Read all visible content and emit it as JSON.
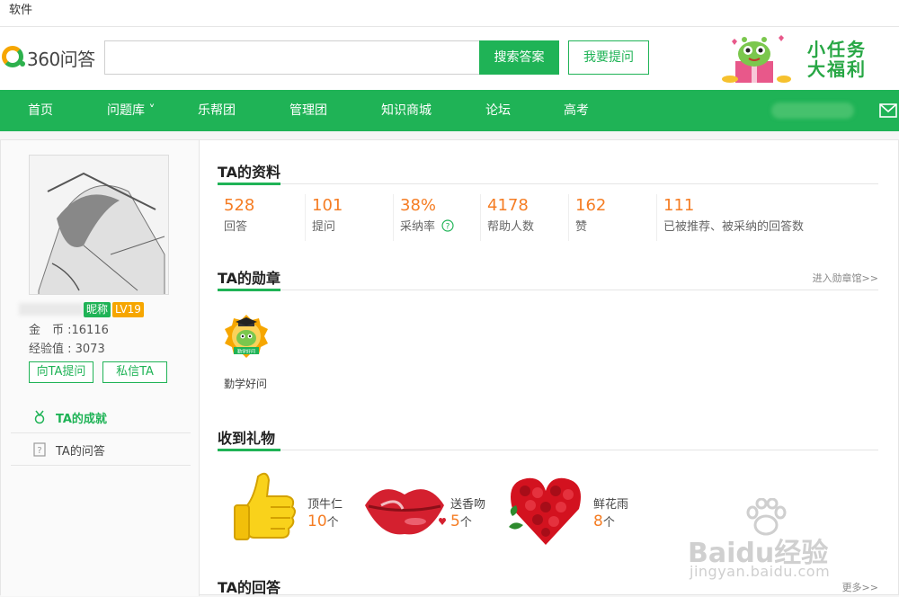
{
  "window": {
    "title": "软件"
  },
  "header": {
    "logo_text": "360问答",
    "search": {
      "placeholder": "",
      "button": "搜索答案"
    },
    "ask_button": "我要提问",
    "promo_line1": "小任务",
    "promo_line2": "大福利"
  },
  "nav": {
    "items": [
      {
        "label": "首页"
      },
      {
        "label": "问题库 ˅"
      },
      {
        "label": "乐帮团"
      },
      {
        "label": "管理团"
      },
      {
        "label": "知识商城"
      },
      {
        "label": "论坛"
      },
      {
        "label": "高考"
      }
    ]
  },
  "profile": {
    "nick_badge": "昵称",
    "level": "LV19",
    "coins": "金　币 :16116",
    "exp": "经验值 : 3073",
    "ask_ta": "向TA提问",
    "message_ta": "私信TA",
    "menu": [
      {
        "label": "TA的成就",
        "active": true
      },
      {
        "label": "TA的问答",
        "active": false
      }
    ]
  },
  "info": {
    "title": "TA的资料",
    "stats": [
      {
        "value": "528",
        "label": "回答"
      },
      {
        "value": "101",
        "label": "提问"
      },
      {
        "value": "38%",
        "label": "采纳率"
      },
      {
        "value": "4178",
        "label": "帮助人数"
      },
      {
        "value": "162",
        "label": "赞"
      },
      {
        "value": "111",
        "label": "已被推荐、被采纳的回答数"
      }
    ]
  },
  "medals": {
    "title": "TA的勋章",
    "more": "进入勋章馆>>",
    "items": [
      {
        "label": "勤学好问",
        "ribbon": "勤学好问"
      }
    ]
  },
  "gifts": {
    "title": "收到礼物",
    "items": [
      {
        "name": "顶牛仁",
        "count": "10",
        "unit": "个"
      },
      {
        "name": "送香吻",
        "count": "5",
        "unit": "个"
      },
      {
        "name": "鲜花雨",
        "count": "8",
        "unit": "个"
      }
    ]
  },
  "answers": {
    "title": "TA的回答",
    "more": "更多>>"
  },
  "watermark": {
    "brand": "Baidu经验",
    "url": "jingyan.baidu.com"
  },
  "colors": {
    "accent": "#1fb356",
    "number": "#f57d24",
    "level": "#f6a600"
  }
}
